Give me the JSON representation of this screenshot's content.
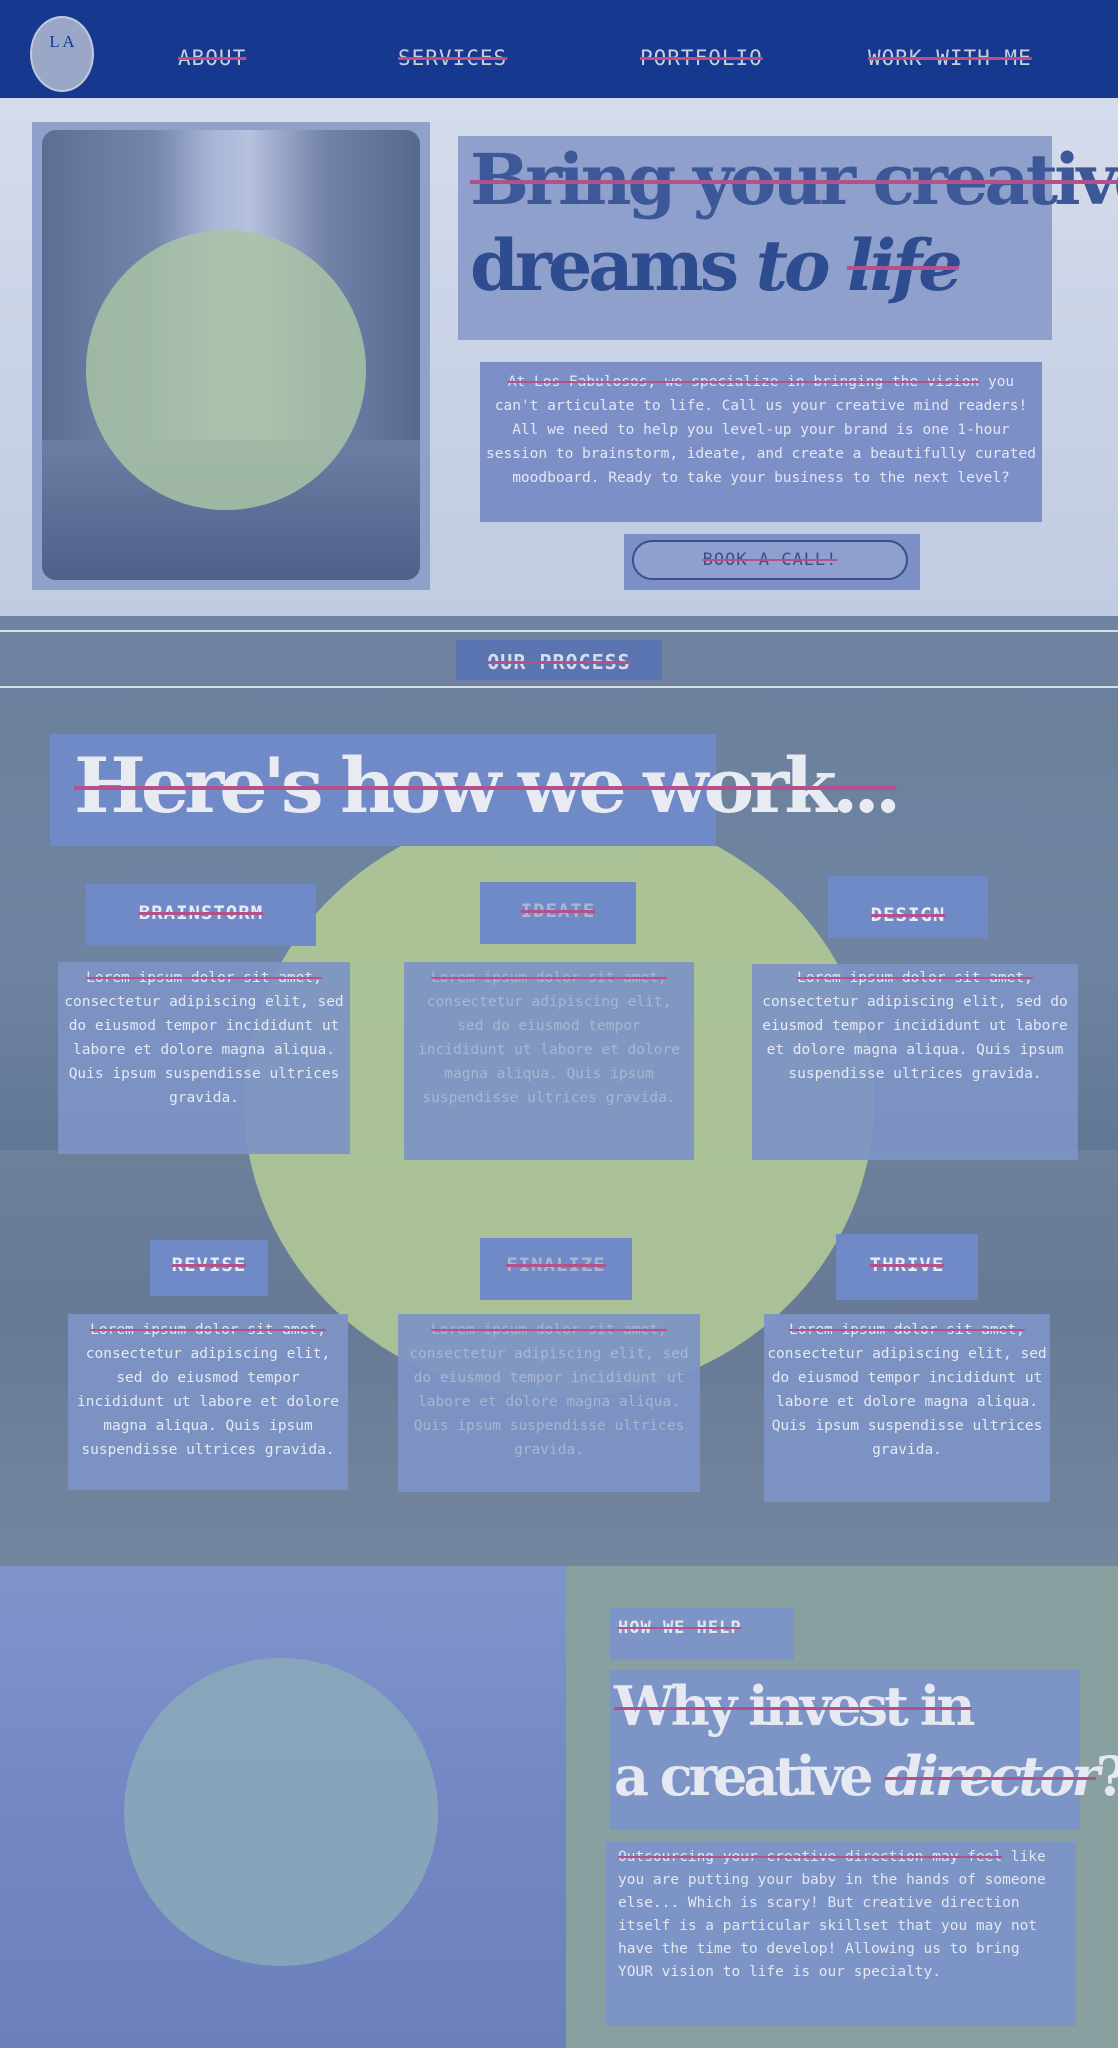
{
  "nav": {
    "logo_letters": "L A",
    "items": [
      "ABOUT",
      "SERVICES",
      "PORTFOLIO",
      "WORK WITH ME"
    ]
  },
  "hero": {
    "headline_line1": "Bring your creative",
    "headline_line2_a": "dreams ",
    "headline_line2_b": "to ",
    "headline_line2_c": "life",
    "intro_first": "At Los Fabulosos, we specialize in bringing the vision",
    "intro_rest": "you can't articulate to life. Call us your creative mind readers! All we need to help you level-up your brand is one 1-hour session to brainstorm, ideate, and create a beautifully curated moodboard. Ready to take your business to the next level?",
    "cta": "BOOK A CALL!"
  },
  "process": {
    "label": "OUR PROCESS",
    "title": "Here's how we work...",
    "steps": [
      {
        "title": "BRAINSTORM",
        "first": "Lorem ipsum dolor sit amet,",
        "rest": "consectetur adipiscing elit, sed do eiusmod tempor incididunt ut labore et dolore magna aliqua. Quis ipsum suspendisse ultrices gravida."
      },
      {
        "title": "IDEATE",
        "first": "Lorem ipsum dolor sit amet,",
        "rest": "consectetur adipiscing elit, sed do eiusmod tempor incididunt ut labore et dolore magna aliqua. Quis ipsum suspendisse ultrices gravida."
      },
      {
        "title": "DESIGN",
        "first": "Lorem ipsum dolor sit amet,",
        "rest": "consectetur adipiscing elit, sed do eiusmod tempor incididunt ut labore et dolore magna aliqua. Quis ipsum suspendisse ultrices gravida."
      },
      {
        "title": "REVISE",
        "first": "Lorem ipsum dolor sit amet,",
        "rest": "consectetur adipiscing elit, sed do eiusmod tempor incididunt ut labore et dolore magna aliqua. Quis ipsum suspendisse ultrices gravida."
      },
      {
        "title": "FINALIZE",
        "first": "Lorem ipsum dolor sit amet,",
        "rest": "consectetur adipiscing elit, sed do eiusmod tempor incididunt ut labore et dolore magna aliqua. Quis ipsum suspendisse ultrices gravida."
      },
      {
        "title": "THRIVE",
        "first": "Lorem ipsum dolor sit amet,",
        "rest": "consectetur adipiscing elit, sed do eiusmod tempor incididunt ut labore et dolore magna aliqua. Quis ipsum suspendisse ultrices gravida."
      }
    ]
  },
  "help": {
    "label": "HOW WE HELP",
    "title_line1": "Why invest in",
    "title_line2_a": "a creative ",
    "title_line2_b": "director",
    "title_line2_c": "?",
    "body_first": "Outsourcing your creative direction may feel",
    "body_rest": "like you are putting your baby in the hands of someone else... Which is scary! But creative direction itself is a particular skillset that you may not have the time to develop! Allowing us to bring YOUR vision to life is our specialty."
  },
  "colors": {
    "nav_bg": "#17388f",
    "accent_strike": "#b3528a",
    "panel_blue": "#7d8fc7",
    "circle_green": "#aec597"
  }
}
